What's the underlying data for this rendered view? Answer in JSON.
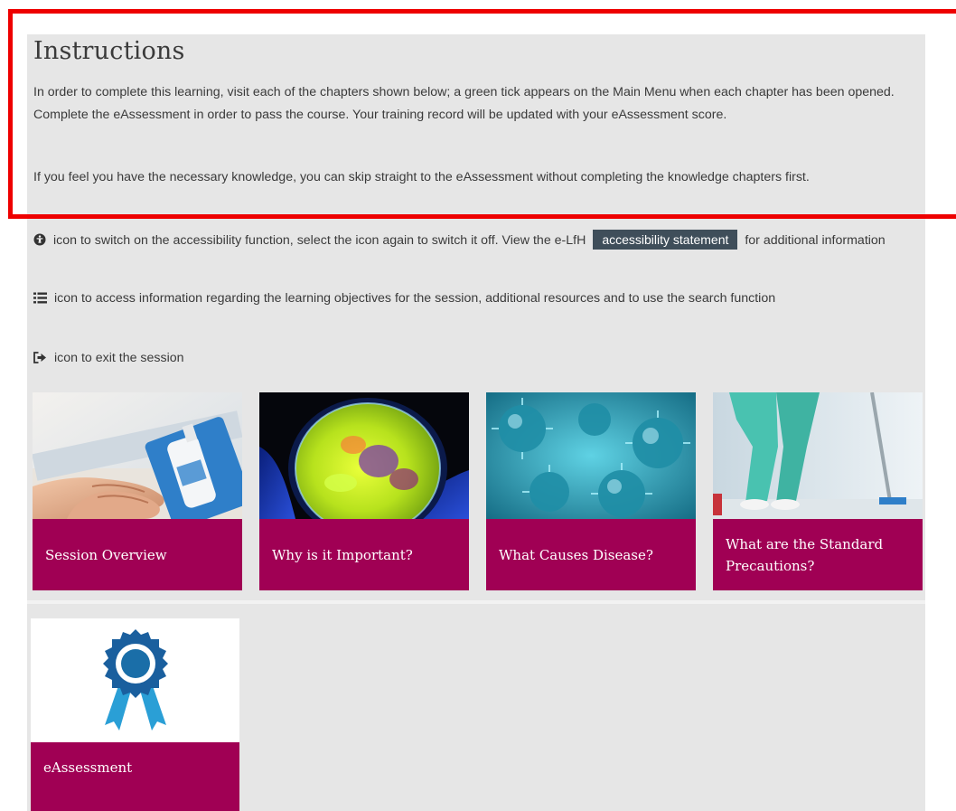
{
  "instructions": {
    "title": "Instructions",
    "para1": "In order to complete this learning, visit each of the chapters shown below; a green tick appears on the Main Menu when each chapter has been opened. Complete the eAssessment in order to pass the course. Your training record will be updated with your eAssessment score.",
    "para2": "If you feel you have the necessary knowledge, you can skip straight to the eAssessment without completing the knowledge chapters first."
  },
  "help": {
    "accessibility_text_before": "icon to switch on the accessibility function, select the icon again to switch it off. View the e-LfH",
    "accessibility_link": "accessibility statement",
    "accessibility_text_after": "for additional information",
    "menu_text": "icon to access information regarding the learning objectives for the session, additional resources and to use the search function",
    "exit_text": "icon to exit the session"
  },
  "chapters": [
    {
      "label": "Session Overview",
      "image": "hand-sanitiser-photo"
    },
    {
      "label": "Why is it Important?",
      "image": "petri-dish-photo"
    },
    {
      "label": "What Causes Disease?",
      "image": "microbes-photo"
    },
    {
      "label": "What are the Standard Precautions?",
      "image": "clinical-scrubs-photo"
    }
  ],
  "assessment": {
    "label": "eAssessment",
    "image": "award-ribbon-icon"
  },
  "colors": {
    "panel_background": "#e6e6e6",
    "card_label_background": "#a00054",
    "link_background": "#3f4e5a",
    "highlight_border": "#ee0000",
    "ribbon_blue": "#1a6ea8"
  }
}
